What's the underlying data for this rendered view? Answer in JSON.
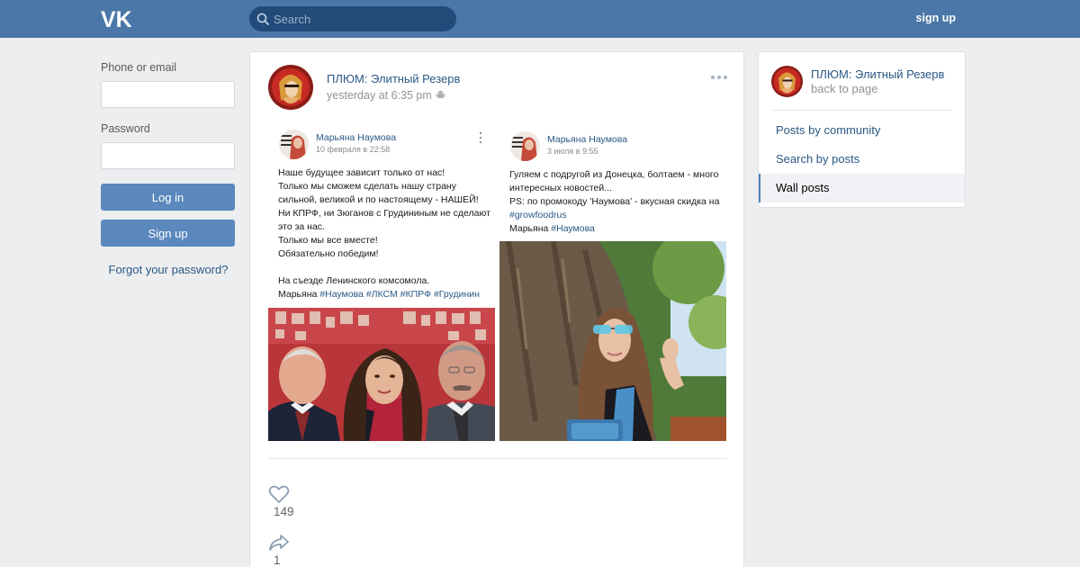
{
  "header": {
    "search_placeholder": "Search",
    "signup_label": "sign up"
  },
  "login": {
    "phone_label": "Phone or email",
    "phone_value": "",
    "password_label": "Password",
    "password_value": "",
    "login_button": "Log in",
    "signup_button": "Sign up",
    "forgot_link": "Forgot your password?"
  },
  "post": {
    "author": "ПЛЮМ: Элитный Резерв",
    "date": "yesterday at 6:35 pm",
    "screenshots": [
      {
        "author": "Марьяна Наумова",
        "date": "10 февраля в 22:58",
        "text": "Наше будущее зависит только от нас!\nТолько мы сможем сделать нашу страну сильной, великой и по настоящему - НАШЕЙ!\nНи КПРФ, ни Зюганов с Грудининым не сделают это за нас.\nТолько мы все вместе!\nОбязательно победим!\n\nНа съезде Ленинского комсомола.\nМарьяна ",
        "tags": "#Наумова #ЛКСМ #КПРФ #Грудинин"
      },
      {
        "author": "Марьяна Наумова",
        "date": "3 июля в 9:55",
        "text": "Гуляем с подругой из Донецка, болтаем - много интересных новостей...\nPS: по промокоду 'Наумова' - вкусная скидка на ",
        "tag1": "#growfoodrus",
        "text2": "\nМарьяна ",
        "tag2": "#Наумова"
      }
    ],
    "likes": "149",
    "shares": "1"
  },
  "sidebar": {
    "community_name": "ПЛЮМ: Элитный Резерв",
    "back_label": "back to page",
    "items": [
      {
        "label": "Posts by community"
      },
      {
        "label": "Search by posts"
      },
      {
        "label": "Wall posts"
      }
    ]
  },
  "colors": {
    "header": "#4a76a8",
    "link": "#2a5885",
    "button": "#5b88bd",
    "background": "#edeef0"
  }
}
